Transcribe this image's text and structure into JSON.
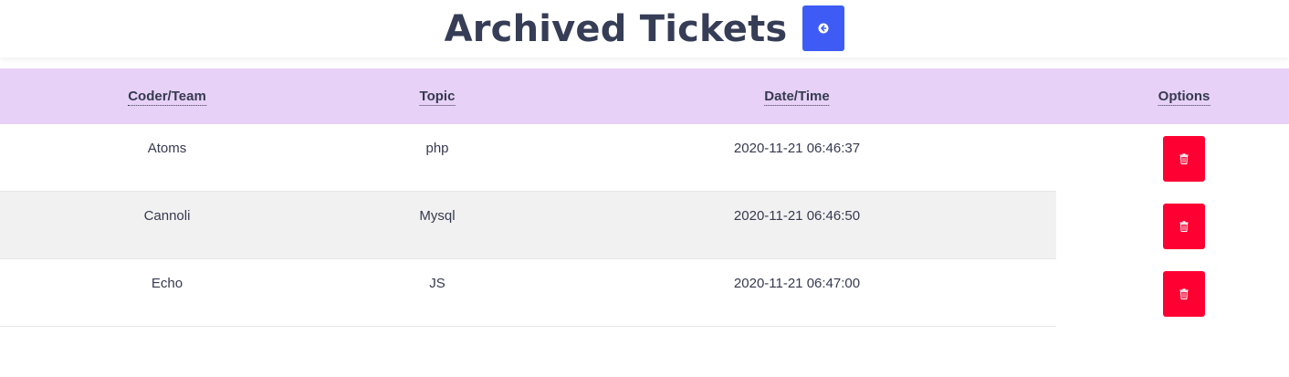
{
  "header": {
    "title": "Archived Tickets",
    "back_icon": "arrow-circle-left-icon"
  },
  "table": {
    "columns": [
      "Coder/Team",
      "Topic",
      "Date/Time",
      "Options"
    ],
    "rows": [
      {
        "team": "Atoms",
        "topic": "php",
        "datetime": "2020-11-21 06:46:37"
      },
      {
        "team": "Cannoli",
        "topic": "Mysql",
        "datetime": "2020-11-21 06:46:50"
      },
      {
        "team": "Echo",
        "topic": "JS",
        "datetime": "2020-11-21 06:47:00"
      }
    ],
    "delete_icon": "trash-icon"
  },
  "colors": {
    "header_bg": "#e7d1f6",
    "back_button": "#3e5cf5",
    "delete_button": "#ff0033",
    "alt_row": "#f1f1f1",
    "text": "#363a4f"
  }
}
